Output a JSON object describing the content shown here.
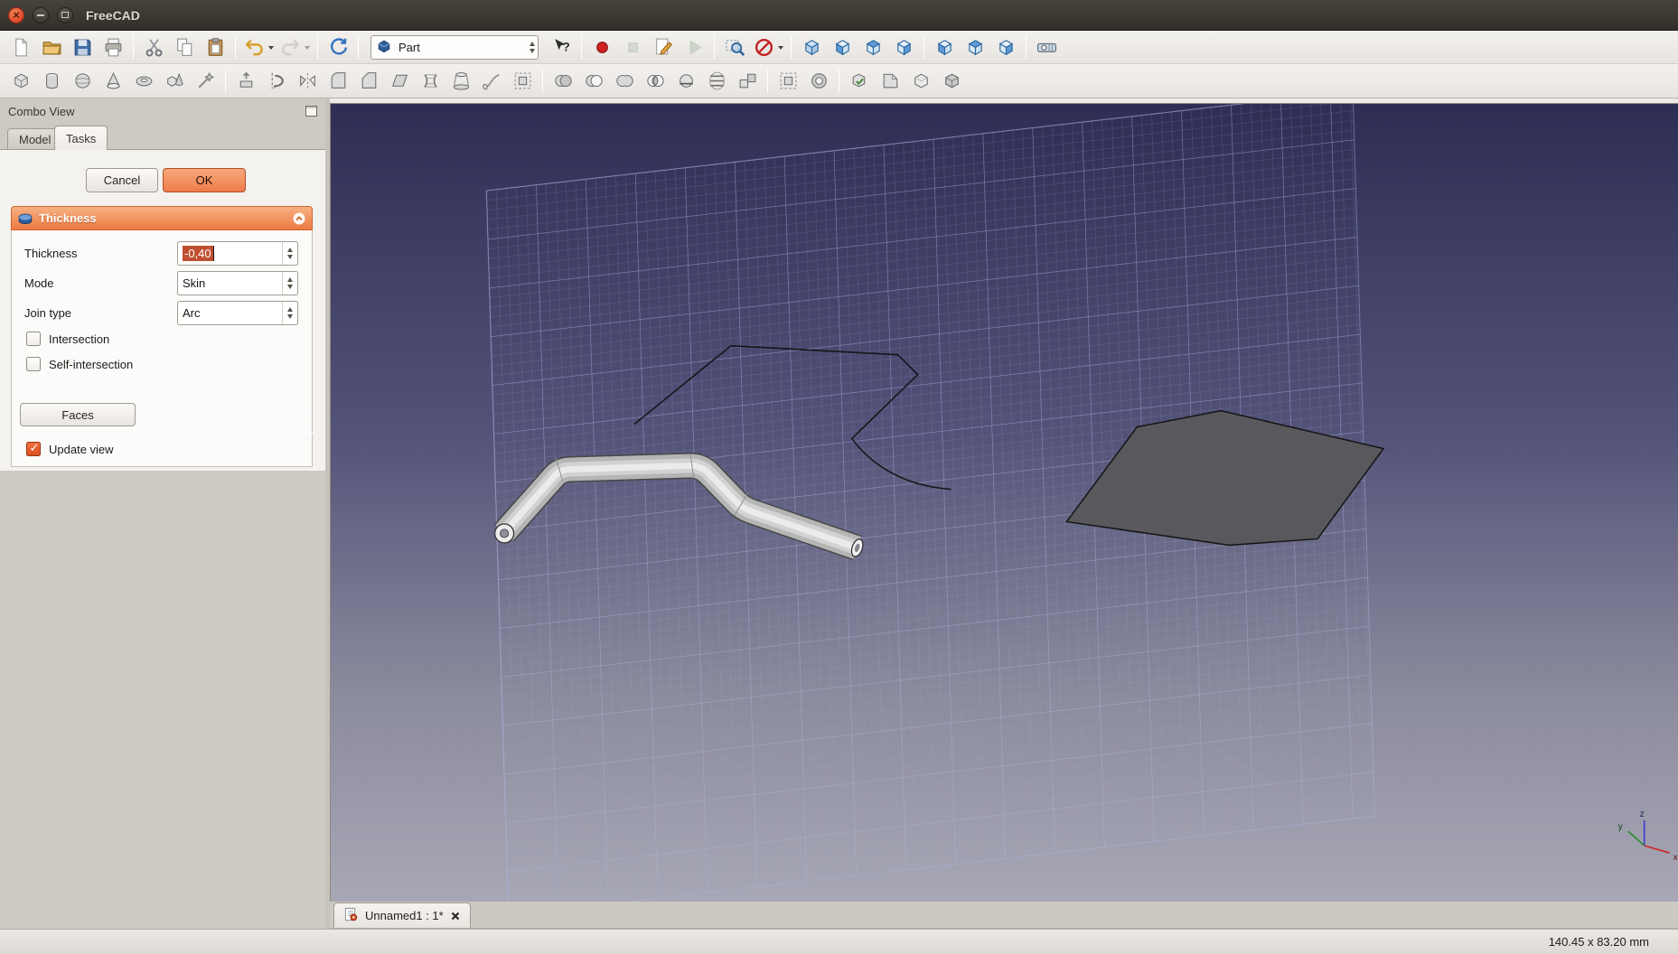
{
  "window": {
    "title": "FreeCAD"
  },
  "toolbar_main": {
    "workbench": {
      "label": "Part"
    },
    "items": [
      {
        "id": "new-document",
        "t": "page"
      },
      {
        "id": "open-document",
        "t": "folder"
      },
      {
        "id": "save-document",
        "t": "save"
      },
      {
        "id": "print",
        "t": "print"
      },
      {
        "sep": true
      },
      {
        "id": "cut",
        "t": "cut"
      },
      {
        "id": "copy",
        "t": "copy"
      },
      {
        "id": "paste",
        "t": "paste"
      },
      {
        "sep": true
      },
      {
        "id": "undo",
        "t": "undo",
        "dropdown": true
      },
      {
        "id": "redo",
        "t": "redo",
        "dropdown": true,
        "disabled": true
      },
      {
        "sep": true
      },
      {
        "id": "refresh",
        "t": "refresh"
      },
      {
        "sep": true
      },
      {
        "widget": "workbench"
      },
      {
        "id": "whats-this",
        "t": "whatsthis"
      },
      {
        "sep": true
      },
      {
        "id": "macro-record",
        "t": "record"
      },
      {
        "id": "macro-stop",
        "t": "stop",
        "disabled": true
      },
      {
        "id": "macro-edit",
        "t": "editmacro"
      },
      {
        "id": "macro-play",
        "t": "play",
        "disabled": true
      },
      {
        "sep": true
      },
      {
        "id": "box-zoom",
        "t": "zoombox"
      },
      {
        "id": "clipping-plane",
        "t": "clip",
        "dropdown": true
      },
      {
        "sep": true
      },
      {
        "id": "view-axonometric",
        "t": "cubeaxo"
      },
      {
        "id": "view-front",
        "t": "cubefront"
      },
      {
        "id": "view-top",
        "t": "cubetop"
      },
      {
        "id": "view-right",
        "t": "cuberight"
      },
      {
        "sep": true
      },
      {
        "id": "view-rear",
        "t": "cuberear"
      },
      {
        "id": "view-bottom",
        "t": "cubebottom"
      },
      {
        "id": "view-left",
        "t": "cubeleft"
      },
      {
        "sep": true
      },
      {
        "id": "measure-distance",
        "t": "measure"
      }
    ]
  },
  "toolbar_part": {
    "items": [
      {
        "id": "part-box",
        "t": "pbox"
      },
      {
        "id": "part-cylinder",
        "t": "pcyl"
      },
      {
        "id": "part-sphere",
        "t": "psph"
      },
      {
        "id": "part-cone",
        "t": "pcone"
      },
      {
        "id": "part-torus",
        "t": "ptorus"
      },
      {
        "id": "part-primitives",
        "t": "pprim"
      },
      {
        "id": "part-shape-builder",
        "t": "pshape"
      },
      {
        "sep": true
      },
      {
        "id": "part-extrude",
        "t": "pextrude"
      },
      {
        "id": "part-revolve",
        "t": "prevolve"
      },
      {
        "id": "part-mirror",
        "t": "pmirror"
      },
      {
        "id": "part-fillet",
        "t": "pfillet"
      },
      {
        "id": "part-chamfer",
        "t": "pchamfer"
      },
      {
        "id": "part-make-face",
        "t": "pface"
      },
      {
        "id": "part-ruled-surface",
        "t": "pruled"
      },
      {
        "id": "part-loft",
        "t": "ploft"
      },
      {
        "id": "part-sweep",
        "t": "psweep"
      },
      {
        "id": "part-offset",
        "t": "poffset"
      },
      {
        "sep": true
      },
      {
        "id": "part-boolean",
        "t": "pbool"
      },
      {
        "id": "part-cut",
        "t": "pcut"
      },
      {
        "id": "part-union",
        "t": "punion"
      },
      {
        "id": "part-intersection",
        "t": "pcommon"
      },
      {
        "id": "part-section",
        "t": "psection"
      },
      {
        "id": "part-cross-sections",
        "t": "pxsect"
      },
      {
        "id": "part-compound",
        "t": "pcompound"
      },
      {
        "sep": true
      },
      {
        "id": "part-offset-3d",
        "t": "poffset"
      },
      {
        "id": "part-thickness",
        "t": "pthick"
      },
      {
        "sep": true
      },
      {
        "id": "part-check-geometry",
        "t": "pcheck"
      },
      {
        "id": "part-defeaturing",
        "t": "pdefeat"
      },
      {
        "id": "part-refine-shape",
        "t": "prefine"
      },
      {
        "id": "part-convert-to-solid",
        "t": "psolid"
      }
    ]
  },
  "combo_view": {
    "title": "Combo View",
    "tabs": [
      {
        "label": "Model"
      },
      {
        "label": "Tasks"
      }
    ],
    "buttons": {
      "cancel": "Cancel",
      "ok": "OK"
    },
    "thickness_panel": {
      "header": "Thickness",
      "fields": [
        {
          "label": "Thickness",
          "value": "-0,40",
          "selected": true
        },
        {
          "label": "Mode",
          "value": "Skin"
        },
        {
          "label": "Join type",
          "value": "Arc"
        }
      ],
      "checkboxes": [
        {
          "label": "Intersection",
          "checked": false
        },
        {
          "label": "Self-intersection",
          "checked": false
        }
      ],
      "faces_button": "Faces",
      "update_view": {
        "label": "Update view",
        "checked": true
      }
    }
  },
  "viewport": {
    "axis": {
      "x": "x",
      "y": "y",
      "z": "z"
    }
  },
  "document_tabs": [
    {
      "label": "Unnamed1 : 1*"
    }
  ],
  "status_bar": {
    "dimensions": "140.45 x 83.20 mm"
  },
  "colors": {
    "accent_orange": "#ee7c49",
    "selection": "#bf4f30",
    "section_header_top": "#f7b183",
    "section_header_bottom": "#ed7a42",
    "viewport_top": "#2e2e55",
    "viewport_bottom": "#a7a7b5"
  }
}
